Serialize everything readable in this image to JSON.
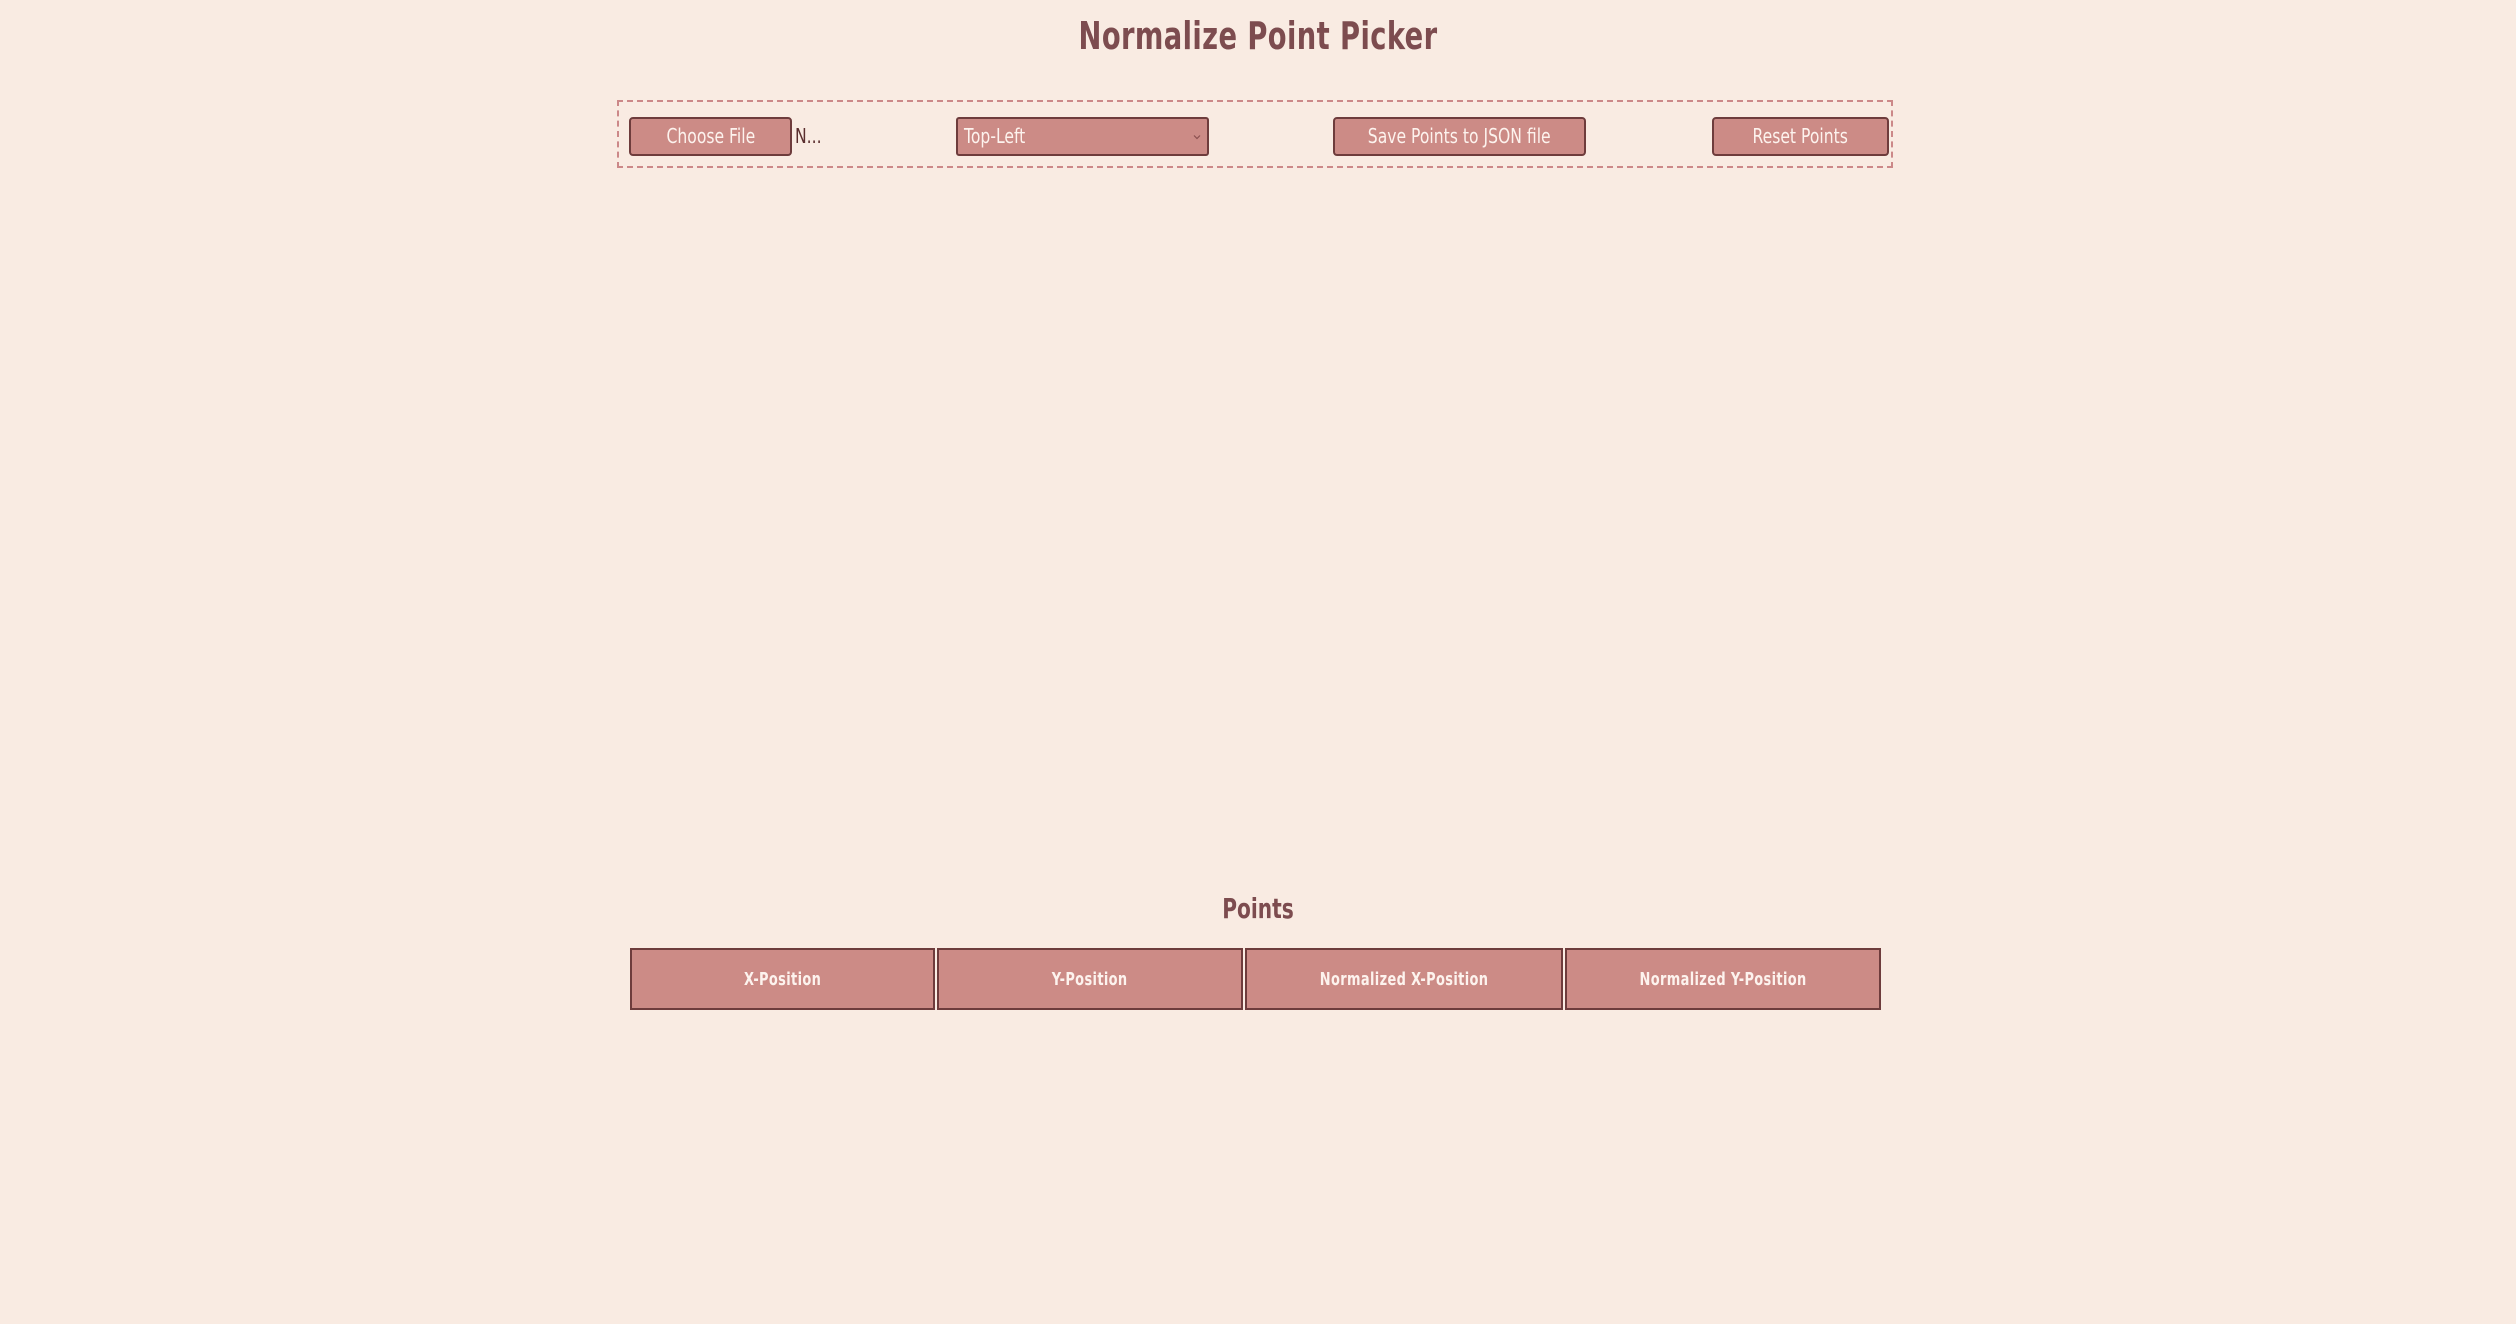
{
  "app": {
    "title": "Normalize Point Picker"
  },
  "toolbar": {
    "choose_file_label": "Choose File",
    "file_status": "N...",
    "origin_select": {
      "selected": "Top-Left"
    },
    "save_label": "Save Points to JSON file",
    "reset_label": "Reset Points"
  },
  "points": {
    "heading": "Points",
    "columns": [
      "X-Position",
      "Y-Position",
      "Normalized X-Position",
      "Normalized Y-Position"
    ],
    "rows": []
  },
  "colors": {
    "background": "#f9ebe2",
    "accent": "#cc8b86",
    "border": "#6e3c3c",
    "heading_text": "#7d4c4f"
  },
  "icons": {
    "select_arrow": "chevron-down-icon"
  }
}
